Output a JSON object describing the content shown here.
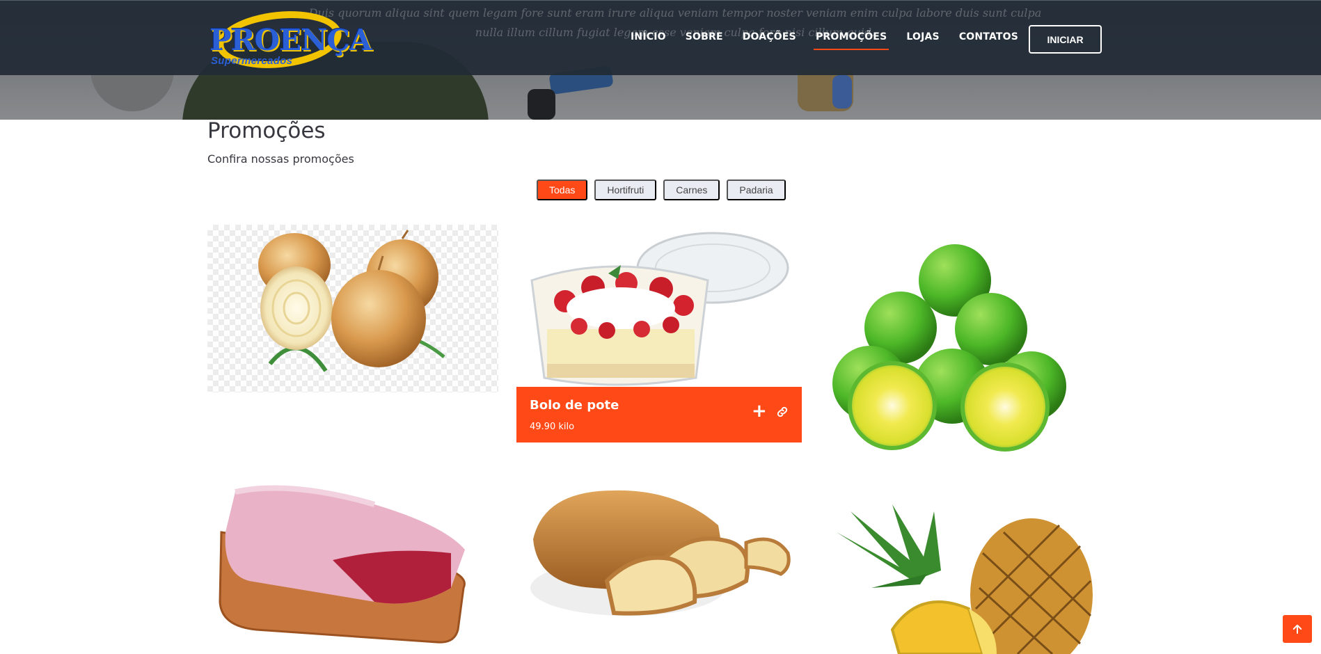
{
  "header": {
    "logo_text": "PROENÇA",
    "logo_subtext": "Supermercados",
    "hero_text": "Duis quorum aliqua sint quem legam fore sunt eram irure aliqua veniam tempor noster veniam enim culpa labore duis sunt culpa nulla illum cillum fugiat legam esse veniam culpa fore nisi cillum quid.",
    "nav": [
      {
        "label": "INÍCIO"
      },
      {
        "label": "SOBRE"
      },
      {
        "label": "DOAÇÕES"
      },
      {
        "label": "PROMOÇÕES"
      },
      {
        "label": "LOJAS"
      },
      {
        "label": "CONTATOS"
      }
    ],
    "active_nav": "PROMOÇÕES",
    "start_label": "INICIAR"
  },
  "section": {
    "title": "Promoções",
    "subtitle": "Confira nossas promoções"
  },
  "filters": [
    {
      "label": "Todas",
      "active": true
    },
    {
      "label": "Hortifruti",
      "active": false
    },
    {
      "label": "Carnes",
      "active": false
    },
    {
      "label": "Padaria",
      "active": false
    }
  ],
  "products": [
    {
      "image": "onions"
    },
    {
      "image": "strawberry-cake-cup",
      "name": "Bolo de pote",
      "price": "49.90 kilo",
      "actions": [
        "plus-icon",
        "link-icon"
      ]
    },
    {
      "image": "limes"
    },
    {
      "image": "beef-cut-on-board"
    },
    {
      "image": "bread-loaf"
    },
    {
      "image": "pineapple"
    }
  ],
  "colors": {
    "accent": "#ff4a17",
    "navbar": "#222c36",
    "filter_bg": "#e9edf3",
    "text": "#37373f"
  },
  "scroll_top_icon": "arrow-up-icon"
}
